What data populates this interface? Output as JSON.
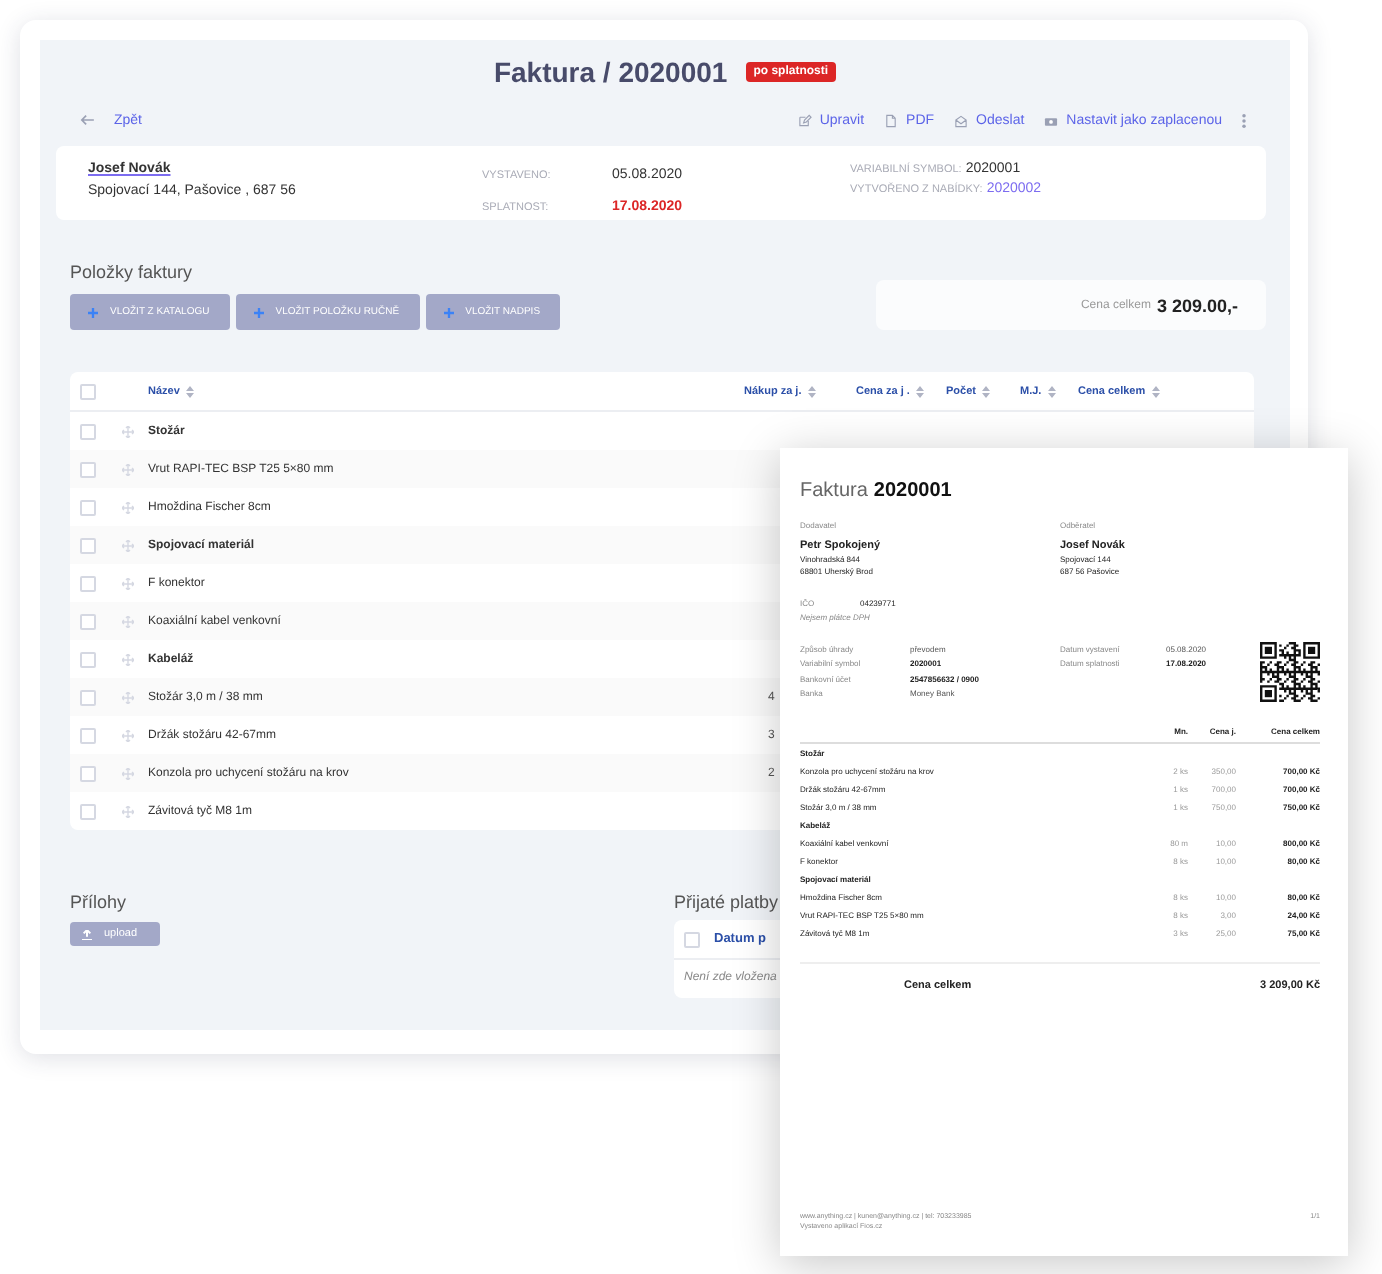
{
  "invoice": {
    "title": "Faktura / 2020001",
    "status_badge": "po splatnosti"
  },
  "nav": {
    "back": "Zpět",
    "actions": [
      {
        "label": "Upravit"
      },
      {
        "label": "PDF"
      },
      {
        "label": "Odeslat"
      },
      {
        "label": "Nastavit jako zaplacenou"
      }
    ]
  },
  "customer": {
    "name": "Josef Novák",
    "address": "Spojovací 144, Pašovice , 687 56"
  },
  "dates": [
    {
      "label": "VYSTAVENO:",
      "value": "05.08.2020",
      "overdue": false
    },
    {
      "label": "SPLATNOST:",
      "value": "17.08.2020",
      "overdue": true
    }
  ],
  "references": [
    {
      "label": "VARIABILNÍ SYMBOL:",
      "value": "2020001",
      "kind": "text"
    },
    {
      "label": "VYTVOŘENO Z NABÍDKY:",
      "value": "2020002",
      "kind": "link"
    }
  ],
  "items_section": {
    "title": "Položky faktury",
    "buttons": [
      "VLOŽIT Z KATALOGU",
      "VLOŽIT POLOŽKU RUČNĚ",
      "VLOŽIT NADPIS"
    ],
    "total_label": "Cena celkem",
    "total_value": "3 209.00,-"
  },
  "table": {
    "select_all_checked": false,
    "columns": [
      "Název",
      "Nákup za j.",
      "Cena za j .",
      "Počet",
      "M.J.",
      "Cena celkem"
    ],
    "rows": [
      {
        "kind": "group",
        "name": "Stožár",
        "checked": false
      },
      {
        "kind": "item",
        "name": "Vrut RAPI-TEC BSP T25 5×80 mm",
        "checked": false
      },
      {
        "kind": "item",
        "name": "Hmoždina Fischer 8cm",
        "checked": false
      },
      {
        "kind": "group",
        "name": "Spojovací materiál",
        "checked": false
      },
      {
        "kind": "item",
        "name": "F konektor",
        "checked": false
      },
      {
        "kind": "item",
        "name": "Koaxiální kabel venkovní",
        "checked": false
      },
      {
        "kind": "group",
        "name": "Kabeláž",
        "checked": false
      },
      {
        "kind": "item",
        "name": "Stožár 3,0 m / 38 mm",
        "purchase": "4",
        "checked": false
      },
      {
        "kind": "item",
        "name": "Držák stožáru 42-67mm",
        "purchase": "3",
        "checked": false
      },
      {
        "kind": "item",
        "name": "Konzola pro uchycení stožáru na krov",
        "purchase": "2",
        "checked": false
      },
      {
        "kind": "item",
        "name": "Závitová tyč M8 1m",
        "checked": false
      }
    ]
  },
  "attachments": {
    "title": "Přílohy",
    "upload": "upload"
  },
  "payments": {
    "title": "Přijaté platby",
    "select_all_checked": false,
    "columns": [
      "Datum p"
    ],
    "empty": "Není zde vložena"
  },
  "document": {
    "title": "Faktura",
    "number": "2020001",
    "supplier": {
      "label": "Dodavatel",
      "name": "Petr Spokojený",
      "lines": [
        "Vinohradská 844",
        "68801 Uherský Brod"
      ]
    },
    "customer": {
      "label": "Odběratel",
      "name": "Josef Novák",
      "lines": [
        "Spojovací 144",
        "687 56 Pašovice"
      ]
    },
    "ico": {
      "label": "IČO",
      "value": "04239771"
    },
    "vat_note": "Nejsem plátce DPH",
    "payment": [
      {
        "label": "Způsob úhrady",
        "value": "převodem",
        "bold": false
      },
      {
        "label": "Variabilní symbol",
        "value": "2020001",
        "bold": true
      },
      {
        "label": "Bankovní účet",
        "value": "2547856632 / 0900",
        "bold": true
      },
      {
        "label": "Banka",
        "value": "Money Bank",
        "bold": false
      }
    ],
    "dates": [
      {
        "label": "Datum vystavení",
        "value": "05.08.2020",
        "bold": false
      },
      {
        "label": "Datum splatnosti",
        "value": "17.08.2020",
        "bold": true
      }
    ],
    "columns": [
      "Mn.",
      "Cena j.",
      "Cena celkem"
    ],
    "rows": [
      {
        "kind": "group",
        "name": "Stožár"
      },
      {
        "kind": "item",
        "name": "Konzola pro uchycení stožáru na krov",
        "qty": "2 ks",
        "price": "350,00",
        "total": "700,00 Kč"
      },
      {
        "kind": "item",
        "name": "Držák stožáru 42-67mm",
        "qty": "1 ks",
        "price": "700,00",
        "total": "700,00 Kč"
      },
      {
        "kind": "item",
        "name": "Stožár 3,0 m / 38 mm",
        "qty": "1 ks",
        "price": "750,00",
        "total": "750,00 Kč"
      },
      {
        "kind": "group",
        "name": "Kabeláž"
      },
      {
        "kind": "item",
        "name": "Koaxiální kabel venkovní",
        "qty": "80 m",
        "price": "10,00",
        "total": "800,00 Kč"
      },
      {
        "kind": "item",
        "name": "F konektor",
        "qty": "8 ks",
        "price": "10,00",
        "total": "80,00 Kč"
      },
      {
        "kind": "group",
        "name": "Spojovací materiál"
      },
      {
        "kind": "item",
        "name": "Hmoždina Fischer 8cm",
        "qty": "8 ks",
        "price": "10,00",
        "total": "80,00 Kč"
      },
      {
        "kind": "item",
        "name": "Vrut RAPI-TEC BSP T25 5×80 mm",
        "qty": "8 ks",
        "price": "3,00",
        "total": "24,00 Kč"
      },
      {
        "kind": "item",
        "name": "Závitová tyč M8 1m",
        "qty": "3 ks",
        "price": "25,00",
        "total": "75,00 Kč"
      }
    ],
    "total_label": "Cena celkem",
    "total_value": "3 209,00 Kč",
    "footer": "www.anything.cz  |  kunen@anything.cz  |  tel: 703233985",
    "generator": "Vystaveno aplikací Fios.cz",
    "page": "1/1"
  }
}
